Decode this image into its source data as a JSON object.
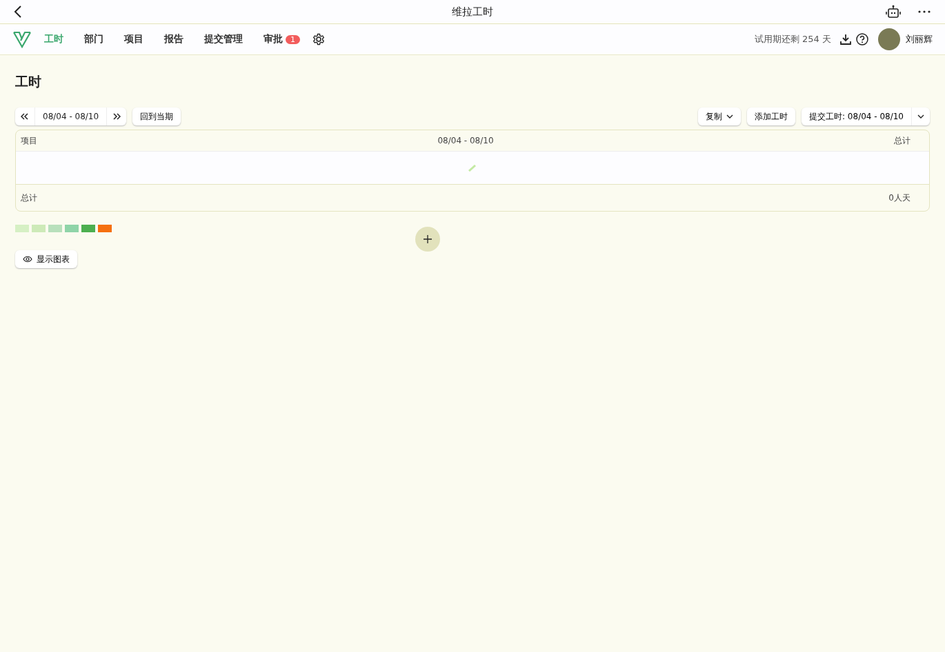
{
  "window": {
    "title": "维拉工时"
  },
  "nav": {
    "tabs": [
      {
        "label": "工时",
        "selected": true
      },
      {
        "label": "部门",
        "selected": false
      },
      {
        "label": "项目",
        "selected": false
      },
      {
        "label": "报告",
        "selected": false
      },
      {
        "label": "提交管理",
        "selected": false
      },
      {
        "label": "审批",
        "selected": false,
        "badge": "1"
      }
    ],
    "trial": "试用期还剩 254 天",
    "user": "刘丽辉"
  },
  "page": {
    "title": "工时",
    "range": "08/04 - 08/10",
    "current_button": "回到当期",
    "copy_button": "复制",
    "add_button": "添加工时",
    "submit_button": "提交工时: 08/04 - 08/10"
  },
  "table": {
    "columns": [
      "项目",
      "08/04 - 08/10",
      "总计"
    ],
    "footer": [
      "总计",
      "0人天"
    ]
  },
  "legend": [
    {
      "color": "#d6f0c4"
    },
    {
      "color": "#cdeab8"
    },
    {
      "color": "#b8e0bc"
    },
    {
      "color": "#8fd4a8"
    },
    {
      "color": "#4caf50"
    },
    {
      "color": "#f57010"
    }
  ],
  "chart_button": "显示图表"
}
